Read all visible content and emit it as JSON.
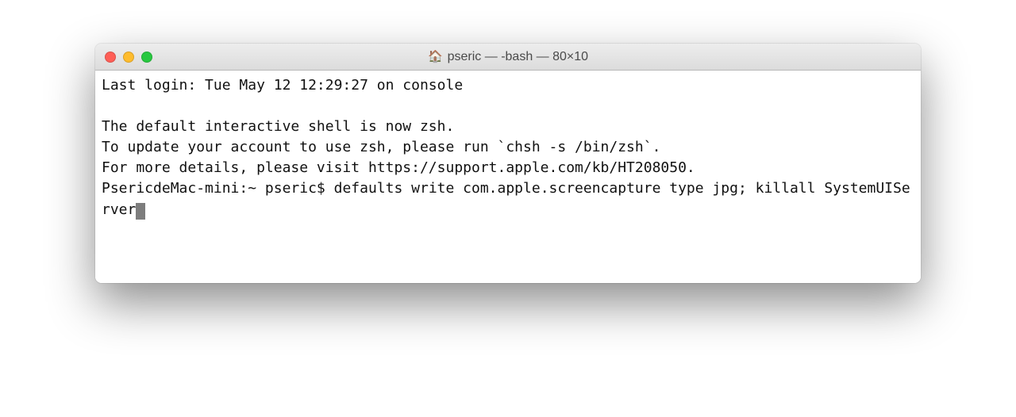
{
  "window": {
    "title": "pseric — -bash — 80×10"
  },
  "terminal": {
    "last_login": "Last login: Tue May 12 12:29:27 on console",
    "blank1": "",
    "zsh_notice_1": "The default interactive shell is now zsh.",
    "zsh_notice_2": "To update your account to use zsh, please run `chsh -s /bin/zsh`.",
    "zsh_notice_3": "For more details, please visit https://support.apple.com/kb/HT208050.",
    "prompt": "PsericdeMac-mini:~ pseric$ ",
    "command": "defaults write com.apple.screencapture type jpg; killall SystemUIServer"
  }
}
